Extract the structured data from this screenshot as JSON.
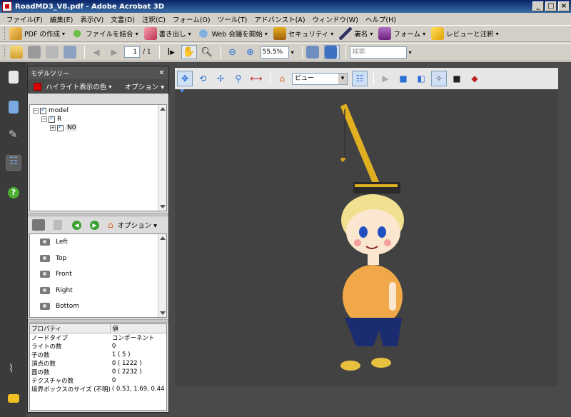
{
  "window": {
    "title": "RoadMD3_V8.pdf - Adobe Acrobat 3D"
  },
  "menu": [
    "ファイル(F)",
    "編集(E)",
    "表示(V)",
    "文書(D)",
    "注釈(C)",
    "フォーム(O)",
    "ツール(T)",
    "アドバンスト(A)",
    "ウィンドウ(W)",
    "ヘルプ(H)"
  ],
  "toolbar1": {
    "create_pdf": "PDF の作成",
    "combine": "ファイルを結合",
    "export": "書き出し",
    "web_meeting": "Web 会議を開始",
    "security": "セキュリティ",
    "sign": "署名",
    "forms": "フォーム",
    "review": "レビューと注釈"
  },
  "toolbar2": {
    "page_current": "1",
    "page_total": "/ 1",
    "zoom": "55.5%",
    "search_placeholder": "検索"
  },
  "model_tree": {
    "title": "モデルツリー",
    "close": "×",
    "highlight_label": "ハイライト表示の色",
    "options_label": "オプション",
    "nodes": [
      {
        "label": "model",
        "toggle": "−"
      },
      {
        "label": "R",
        "toggle": "−"
      },
      {
        "label": "N0",
        "toggle": "+"
      }
    ]
  },
  "views": {
    "options_label": "オプション",
    "items": [
      "Left",
      "Top",
      "Front",
      "Right",
      "Bottom"
    ]
  },
  "properties": {
    "col_property": "プロパティ",
    "col_value": "値",
    "rows": [
      {
        "k": "ノードタイプ",
        "v": "コンポーネント"
      },
      {
        "k": "ライトの数",
        "v": "0"
      },
      {
        "k": "子の数",
        "v": "1 ( 5 )"
      },
      {
        "k": "頂点の数",
        "v": "0 ( 1222 )"
      },
      {
        "k": "面の数",
        "v": "0 ( 2232 )"
      },
      {
        "k": "テクスチャの数",
        "v": "0"
      },
      {
        "k": "境界ボックスのサイズ (不明)",
        "v": "( 0.53, 1.69, 0.44 )"
      }
    ]
  },
  "viewer_toolbar": {
    "view_select": "ビュー"
  },
  "colors": {
    "accent": "#0a246a",
    "viewer_bg": "#424242",
    "highlight": "#dd0000"
  }
}
